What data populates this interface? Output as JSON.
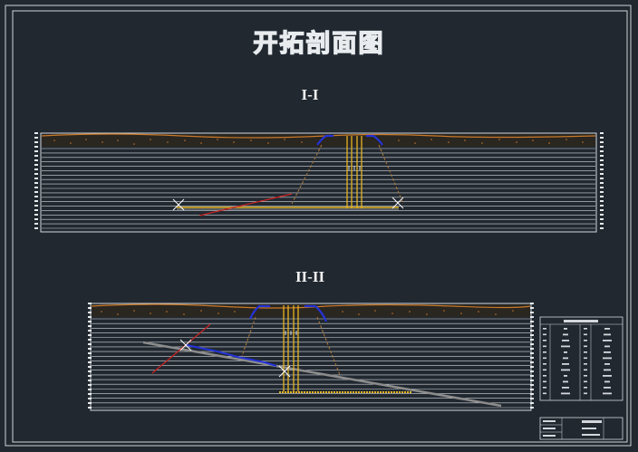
{
  "drawing": {
    "title": "开拓剖面图",
    "section_1_label": "I-I",
    "section_2_label": "II-II"
  },
  "colors": {
    "background": "#212830",
    "frame": "#cfd4d8",
    "strata": "#d4d8dc",
    "soil": "#c97a2a",
    "shaft": "#e6b422",
    "roadway": "#2433d6",
    "fault": "#cc2222",
    "slope_line": "#b07a3a",
    "coal_seam": "#8c8c8c"
  },
  "icons": {
    "roadway_junction": "x-cross-icon"
  }
}
